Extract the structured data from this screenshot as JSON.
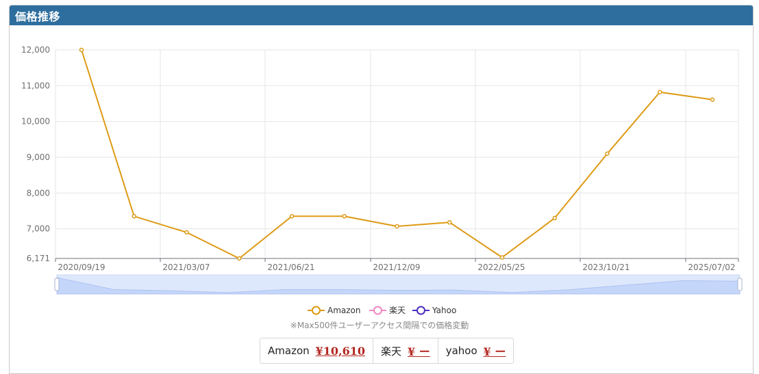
{
  "panel": {
    "title": "価格推移"
  },
  "chart_data": {
    "type": "line",
    "x": [
      "2020/09/19",
      "",
      "2021/03/07",
      "",
      "2021/06/21",
      "",
      "2021/12/09",
      "",
      "2022/05/25",
      "",
      "2023/10/21",
      "",
      "2025/07/02"
    ],
    "x_tick_labels": [
      "2020/09/19",
      "2021/03/07",
      "2021/06/21",
      "2021/12/09",
      "2022/05/25",
      "2023/10/21",
      "2025/07/02"
    ],
    "series": [
      {
        "name": "Amazon",
        "color": "#dd9a14",
        "values": [
          12000,
          7350,
          6900,
          6171,
          7350,
          7350,
          7070,
          7180,
          6200,
          7300,
          9100,
          10820,
          10610
        ]
      }
    ],
    "ylim": [
      6171,
      12000
    ],
    "y_ticks": [
      "12,000",
      "11,000",
      "10,000",
      "9,000",
      "8,000",
      "7,000",
      "6,171"
    ],
    "grid": true,
    "legend": [
      {
        "label": "Amazon",
        "color": "#dd9a14"
      },
      {
        "label": "楽天",
        "color": "#ee86c2"
      },
      {
        "label": "Yahoo",
        "color": "#4b2dbe"
      }
    ],
    "legend_position": "bottom"
  },
  "note": "※Max500件ユーザーアクセス間隔での価格変動",
  "prices": [
    {
      "store": "Amazon",
      "value": "¥10,610"
    },
    {
      "store": "楽天",
      "value": "¥ ー"
    },
    {
      "store": "yahoo",
      "value": "¥ ー"
    }
  ]
}
